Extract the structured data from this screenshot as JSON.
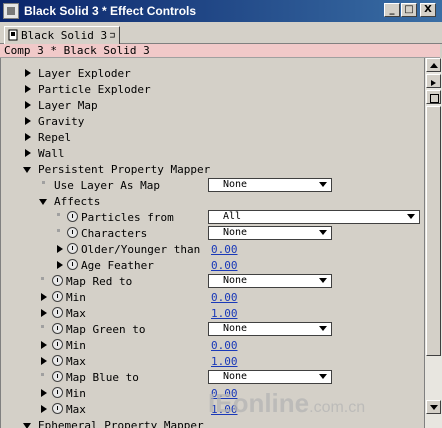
{
  "window": {
    "title": "Black Solid 3 * Effect Controls",
    "min_label": "_",
    "max_label": "□",
    "close_label": "X"
  },
  "tab": {
    "label": "Black Solid 3",
    "close": "⊐"
  },
  "comp_header": "Comp 3 * Black Solid 3",
  "effects": [
    "Layer Exploder",
    "Particle Exploder",
    "Layer Map",
    "Gravity",
    "Repel",
    "Wall"
  ],
  "ppm": {
    "label": "Persistent Property Mapper",
    "use_layer_as_map": {
      "label": "Use Layer As Map",
      "value": "None"
    },
    "affects": {
      "label": "Affects",
      "particles_from": {
        "label": "Particles from",
        "value": "All"
      },
      "characters": {
        "label": "Characters",
        "value": "None"
      },
      "older_younger": {
        "label": "Older/Younger than",
        "value": "0.00"
      },
      "age_feather": {
        "label": "Age Feather",
        "value": "0.00"
      }
    },
    "map_red": {
      "label": "Map Red to",
      "value": "None"
    },
    "red_min": {
      "label": "Min",
      "value": "0.00"
    },
    "red_max": {
      "label": "Max",
      "value": "1.00"
    },
    "map_green": {
      "label": "Map Green to",
      "value": "None"
    },
    "green_min": {
      "label": "Min",
      "value": "0.00"
    },
    "green_max": {
      "label": "Max",
      "value": "1.00"
    },
    "map_blue": {
      "label": "Map Blue to",
      "value": "None"
    },
    "blue_min": {
      "label": "Min",
      "value": "0.00"
    },
    "blue_max": {
      "label": "Max",
      "value": "1.00"
    }
  },
  "next_effect": "Ephemeral Property Mapper",
  "watermark": {
    "main": "IEonline",
    "suffix": ".com.cn"
  },
  "colors": {
    "title_bar": "#0a246a",
    "comp_header": "#f1c9c9",
    "value_link": "#1a39b8"
  }
}
